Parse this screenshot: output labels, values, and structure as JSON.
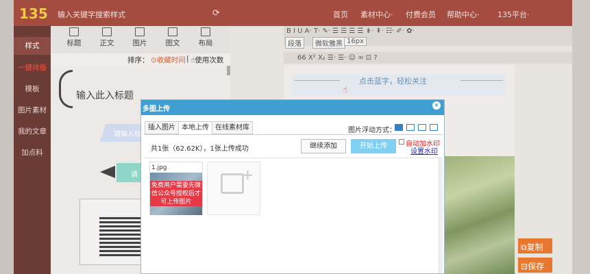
{
  "header": {
    "logo": "135",
    "search_placeholder": "输入关键字搜索样式",
    "nav": [
      "首页",
      "素材中心",
      "付费会员",
      "帮助中心",
      "135平台"
    ]
  },
  "sidebar": {
    "items": [
      {
        "label": "样式",
        "active": true
      },
      {
        "label": "一键排版",
        "highlight": true
      },
      {
        "label": "模板"
      },
      {
        "label": "图片素材"
      },
      {
        "label": "我的文章"
      },
      {
        "label": "加点料"
      }
    ]
  },
  "tools": {
    "items": [
      "标题",
      "正文",
      "图片",
      "图文",
      "布局"
    ],
    "sort_label": "排序：",
    "sort_fav": "收藏时间",
    "sort_sep": "|",
    "sort_use": "使用次数",
    "preview_title": "输入此入标题",
    "preview_sub1": "请输入标",
    "preview_sub2": "请"
  },
  "editor": {
    "toolbar_row1": "B  I  U  A·  T·  ✎·   ☰ ☰ ☰ ☰  ⇟·  ⇞·  ☷·   ✐·  ✿·",
    "font_block": "段落",
    "font_family": "微软雅黑",
    "font_size": "16px",
    "toolbar_row3": "66  X²  X₂  ☰·  ☰·  ☺  ∞  ⊡  ?",
    "banner_text": "点击蓝字，轻松关注",
    "copy_label": "复制",
    "save_label": "保存"
  },
  "dialog": {
    "title": "多图上传",
    "close": "×",
    "tabs": [
      "插入图片",
      "本地上传",
      "在线素材库"
    ],
    "active_tab": 1,
    "float_label": "图片浮动方式：",
    "status": "共1张（62.62K），1张上传成功",
    "continue_label": "继续添加",
    "start_label": "开始上传",
    "watermark_label": "自动加水印",
    "watermark_setting": "设置水印",
    "file_name": "1.jpg",
    "overlay_text": "免费用户需要先微信公众号授权后才可上传图片"
  },
  "colors": {
    "header": "#a44c40",
    "sidebar": "#6b3b36",
    "dialog_header": "#3f9fd3",
    "upload_btn": "#7fd0f2",
    "overlay": "#e63946",
    "action_btn": "#e8782f"
  }
}
